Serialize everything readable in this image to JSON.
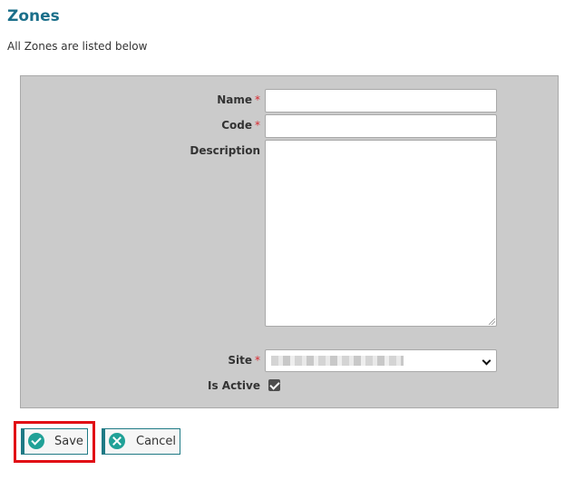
{
  "page": {
    "title": "Zones",
    "subtitle": "All Zones are listed below"
  },
  "form": {
    "required_marker": "*",
    "fields": {
      "name": {
        "label": "Name",
        "value": "",
        "required": true
      },
      "code": {
        "label": "Code",
        "value": "",
        "required": true
      },
      "description": {
        "label": "Description",
        "value": "",
        "required": false
      },
      "site": {
        "label": "Site",
        "selected_value": "",
        "required": true,
        "value_obscured": true
      },
      "is_active": {
        "label": "Is Active",
        "checked": true
      }
    }
  },
  "actions": {
    "save_label": "Save",
    "save_icon": "check-circle-icon",
    "cancel_label": "Cancel",
    "cancel_icon": "x-circle-icon",
    "highlighted_button": "save"
  },
  "colors": {
    "title": "#1b6f8a",
    "panel_background": "#cbcbcb",
    "required": "#d9272e",
    "button_accent": "#1f7a85",
    "icon_background": "#21a197",
    "highlight": "#e10d15"
  }
}
